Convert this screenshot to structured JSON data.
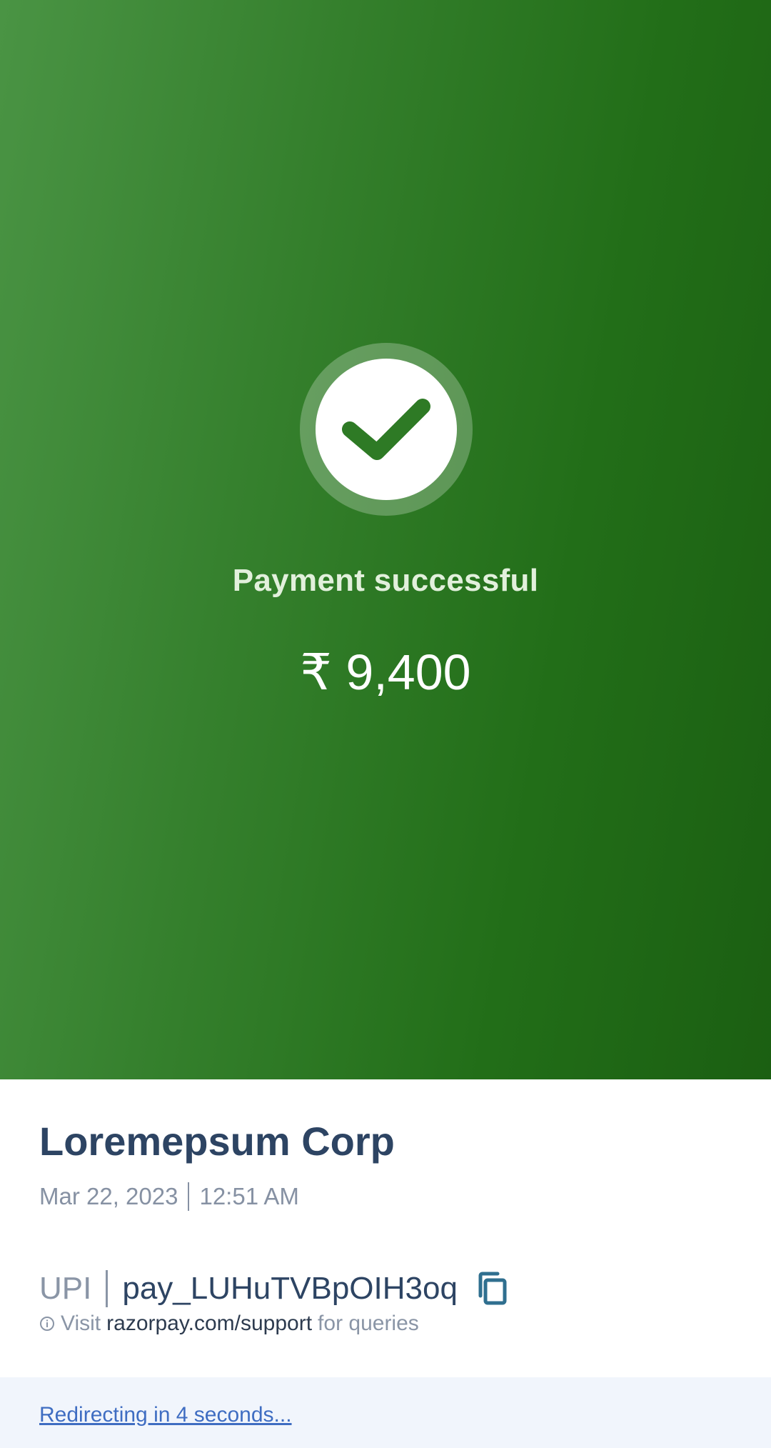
{
  "status": {
    "message": "Payment successful",
    "amount": "₹ 9,400",
    "icon": "check-circle-icon"
  },
  "details": {
    "merchant": "Loremepsum Corp",
    "date": "Mar 22, 2023",
    "time": "12:51 AM",
    "method": "UPI",
    "payment_id": "pay_LUHuTVBpOIH3oq",
    "copy_icon": "copy-icon",
    "support_prefix": "Visit",
    "support_link": "razorpay.com/support",
    "support_suffix": "for queries",
    "info_icon": "info-icon"
  },
  "footer": {
    "redirect_text": "Redirecting in 4 seconds..."
  },
  "colors": {
    "success_green": "#2e7a25",
    "merchant_text": "#2d4463",
    "link_blue": "#3f6dc2",
    "footer_bg": "#f1f5fc"
  }
}
